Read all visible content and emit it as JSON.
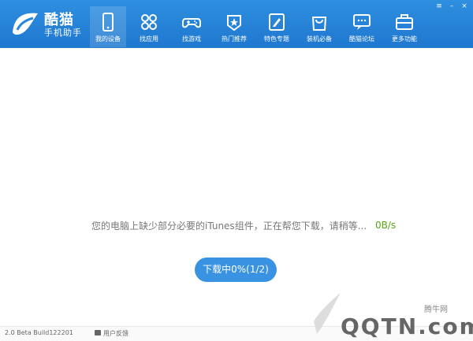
{
  "app": {
    "title_line1": "酷猫",
    "title_line2": "手机助手"
  },
  "nav": [
    {
      "label": "我的设备",
      "icon": "phone-icon",
      "active": true
    },
    {
      "label": "找应用",
      "icon": "apps-icon",
      "active": false
    },
    {
      "label": "找游戏",
      "icon": "gamepad-icon",
      "active": false
    },
    {
      "label": "热门推荐",
      "icon": "star-badge-icon",
      "active": false
    },
    {
      "label": "特色专题",
      "icon": "pencil-icon",
      "active": false
    },
    {
      "label": "装机必备",
      "icon": "bag-icon",
      "active": false
    },
    {
      "label": "酷猫论坛",
      "icon": "chat-icon",
      "active": false
    },
    {
      "label": "更多功能",
      "icon": "toolbox-icon",
      "active": false
    }
  ],
  "main": {
    "message": "您的电脑上缺少部分必要的iTunes组件，正在帮您下载，请稍等...",
    "speed": "0B/s",
    "download_button": "下载中0%(1/2)"
  },
  "footer": {
    "build": "2.0 Beta Build122201",
    "feedback": "用户反馈"
  },
  "watermark": {
    "brand": "QQTN.com",
    "subtitle": "腾牛网"
  },
  "colors": {
    "header": "#2a86dc",
    "button": "#3a93e2",
    "speed": "#55a511"
  }
}
